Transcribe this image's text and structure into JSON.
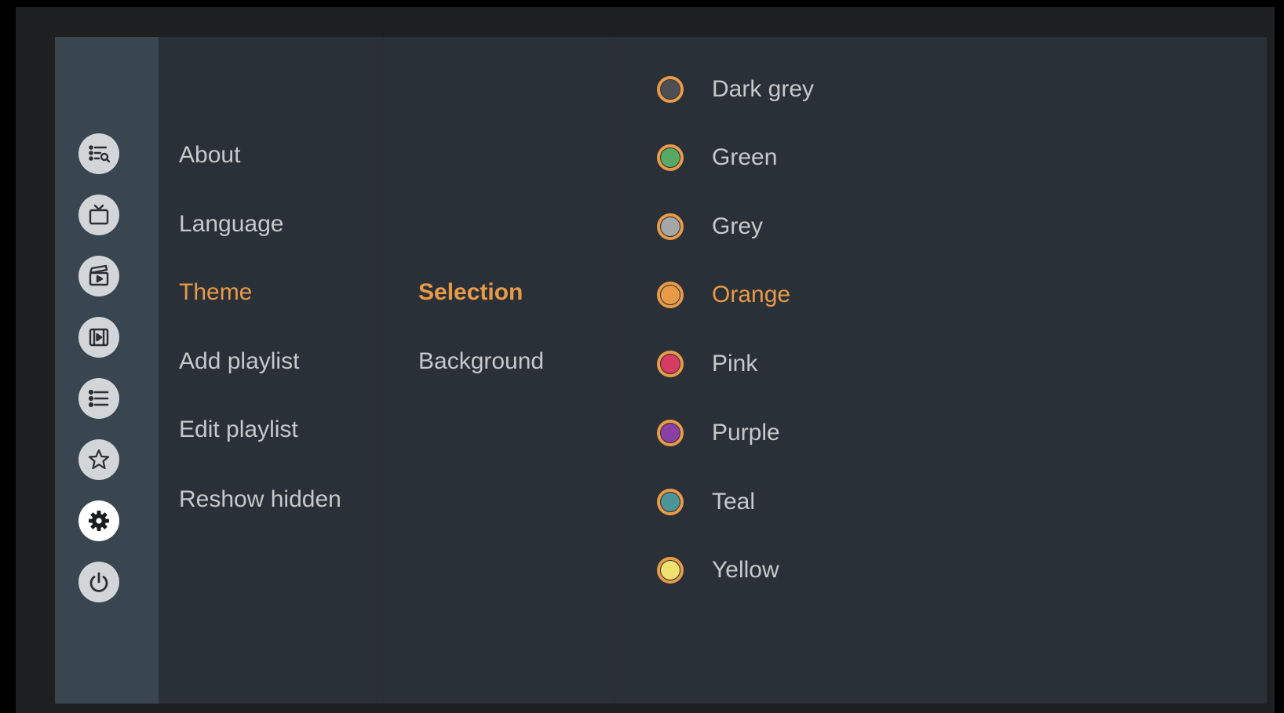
{
  "sidebar": {
    "icons": [
      {
        "name": "list-search-icon"
      },
      {
        "name": "tv-icon"
      },
      {
        "name": "clapperboard-icon"
      },
      {
        "name": "video-play-icon"
      },
      {
        "name": "list-icon"
      },
      {
        "name": "star-icon"
      },
      {
        "name": "settings-gear-icon",
        "active": true
      },
      {
        "name": "power-icon"
      }
    ]
  },
  "settings_menu": {
    "items": [
      "About",
      "Language",
      "Theme",
      "Add playlist",
      "Edit playlist",
      "Reshow hidden"
    ],
    "active": "Theme"
  },
  "theme_submenu": {
    "items": [
      "Selection",
      "Background"
    ],
    "active": "Selection"
  },
  "colour_options": {
    "items": [
      {
        "label": "Dark grey",
        "color": "#4d4f52"
      },
      {
        "label": "Green",
        "color": "#58a866"
      },
      {
        "label": "Grey",
        "color": "#a4a6a8"
      },
      {
        "label": "Orange",
        "color": "#e99a46"
      },
      {
        "label": "Pink",
        "color": "#d63b63"
      },
      {
        "label": "Purple",
        "color": "#8a3fa4"
      },
      {
        "label": "Teal",
        "color": "#4d9496"
      },
      {
        "label": "Yellow",
        "color": "#eee16d"
      }
    ],
    "selected": "Orange",
    "ring_color": "#e99a46"
  },
  "colors": {
    "accent": "#e99a46",
    "text": "#c5c9cc",
    "background": "#2a3038",
    "sidebar": "#394650"
  }
}
